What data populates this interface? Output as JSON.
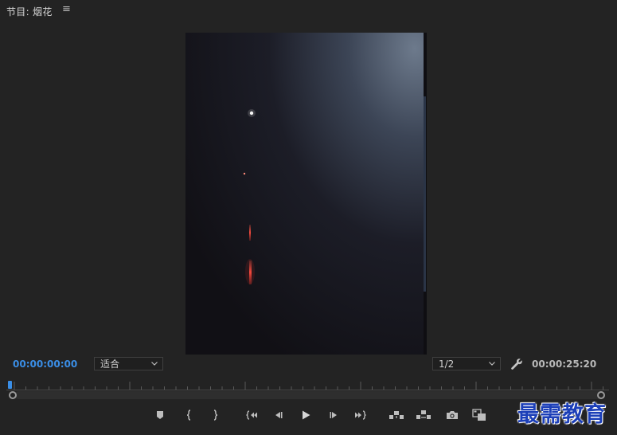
{
  "panel": {
    "title": "节目: 烟花",
    "menu_icon": "hamburger-menu-icon"
  },
  "viewer": {
    "content": "night-sky-fireworks-frame"
  },
  "timecode": {
    "current": "00:00:00:00",
    "duration": "00:00:25:20"
  },
  "zoom": {
    "selected": "适合"
  },
  "resolution": {
    "selected": "1/2"
  },
  "playhead_position": 0,
  "transport": {
    "buttons": [
      "add-marker-icon",
      "mark-in-icon",
      "mark-out-icon",
      "go-to-in-icon",
      "step-back-icon",
      "play-icon",
      "step-forward-icon",
      "go-to-out-icon",
      "lift-icon",
      "extract-icon",
      "export-frame-icon",
      "comparison-view-icon"
    ]
  },
  "watermark": {
    "text": "最需教育"
  },
  "colors": {
    "background": "#232323",
    "timecode_active": "#3a8ee6",
    "playhead": "#3a8ee6",
    "watermark": "#1c3fb8"
  }
}
